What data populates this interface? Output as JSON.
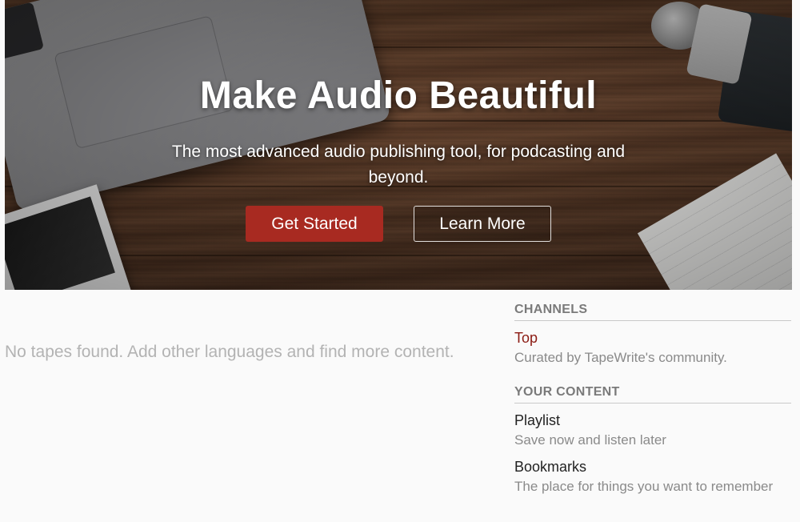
{
  "hero": {
    "title": "Make Audio Beautiful",
    "subtitle": "The most advanced audio publishing tool, for podcasting and beyond.",
    "get_started_label": "Get Started",
    "learn_more_label": "Learn More"
  },
  "main": {
    "empty_message": "No tapes found. Add other languages and find more content."
  },
  "sidebar": {
    "channels": {
      "heading": "CHANNELS",
      "items": [
        {
          "label": "Top",
          "description": "Curated by TapeWrite's community."
        }
      ]
    },
    "your_content": {
      "heading": "YOUR CONTENT",
      "items": [
        {
          "label": "Playlist",
          "description": "Save now and listen later"
        },
        {
          "label": "Bookmarks",
          "description": "The place for things you want to remember"
        }
      ]
    }
  },
  "colors": {
    "primary_button": "#a82a21",
    "channel_link": "#8b1a12",
    "muted_text": "#8a8a8a",
    "empty_text": "#b3b3b3"
  }
}
